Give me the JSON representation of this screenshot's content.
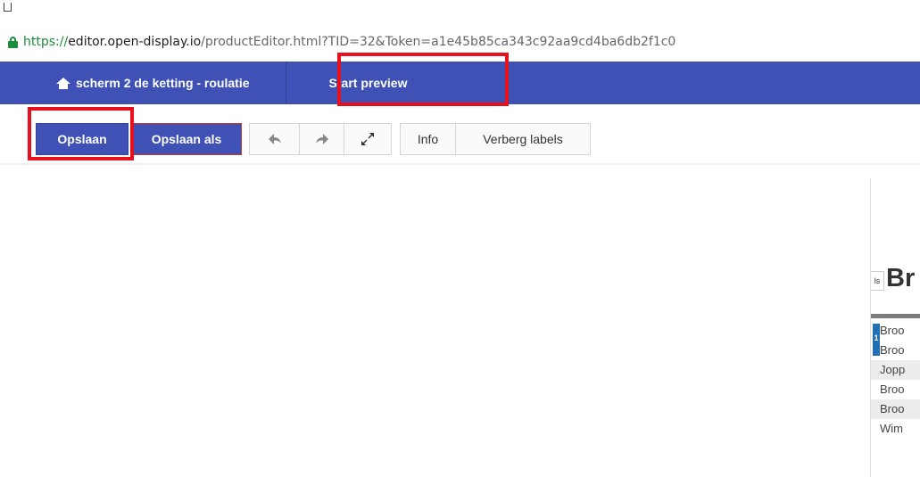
{
  "browser": {
    "url_scheme": "https://",
    "url_host": "editor.open-display.io",
    "url_rest": "/productEditor.html?TID=32&Token=a1e45b85ca343c92aa9cd4ba6db2f1c0"
  },
  "navbar": {
    "home_label": "scherm 2 de ketting - roulatie",
    "preview_label": "Start preview",
    "color": "#3f51b5"
  },
  "toolbar": {
    "save_label": "Opslaan",
    "save_as_label": "Opslaan als",
    "undo_icon": "undo-arrow-icon",
    "redo_icon": "redo-arrow-icon",
    "fullscreen_icon": "expand-icon",
    "info_label": "Info",
    "hide_labels_label": "Verberg labels"
  },
  "highlights": {
    "color": "#e8101c"
  },
  "preview": {
    "side_label": "ls",
    "title": "Br",
    "badge": "1",
    "rows": [
      "Broo",
      "Broo",
      "Jopp",
      "Broo",
      "Broo",
      "Wim"
    ]
  }
}
